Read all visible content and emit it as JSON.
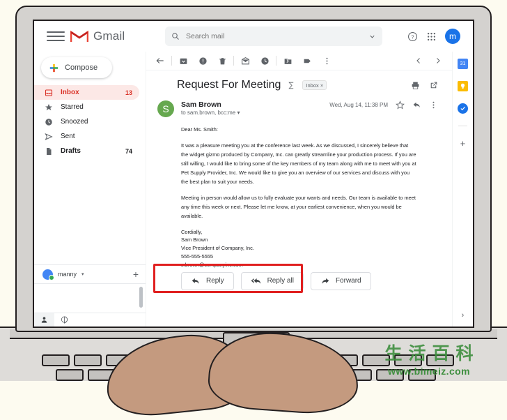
{
  "app": {
    "name": "Gmail"
  },
  "header": {
    "menu_icon": "hamburger-icon",
    "logo_icon": "gmail-m-logo",
    "logo_text": "Gmail",
    "search": {
      "icon": "search-icon",
      "placeholder": "Search mail",
      "value": "",
      "dropdown_icon": "chevron-down-icon"
    },
    "help_icon": "help-circle-icon",
    "apps_icon": "apps-grid-icon",
    "avatar_letter": "m",
    "avatar_color": "#1a73e8"
  },
  "sidebar": {
    "compose": {
      "label": "Compose",
      "icon": "plus-icon"
    },
    "items": [
      {
        "label": "Inbox",
        "icon": "inbox-icon",
        "count": "13",
        "active": true
      },
      {
        "label": "Starred",
        "icon": "star-icon",
        "count": "",
        "active": false
      },
      {
        "label": "Snoozed",
        "icon": "clock-icon",
        "count": "",
        "active": false
      },
      {
        "label": "Sent",
        "icon": "send-icon",
        "count": "",
        "active": false
      },
      {
        "label": "Drafts",
        "icon": "draft-icon",
        "count": "74",
        "active": false
      }
    ],
    "hangouts": {
      "user_name": "manny",
      "caret_icon": "chevron-down-icon",
      "add_icon": "plus-icon",
      "status_color": "#34a853",
      "tabs": [
        "person-icon",
        "hangouts-icon"
      ]
    }
  },
  "toolbar": {
    "icons": [
      "back-arrow-icon",
      "archive-icon",
      "report-spam-icon",
      "delete-icon",
      "mark-unread-icon",
      "snooze-icon",
      "move-to-icon",
      "labels-icon",
      "more-options-icon"
    ],
    "prev_icon": "chevron-left-icon",
    "next_icon": "chevron-right-icon"
  },
  "email": {
    "subject": "Request For Meeting",
    "thread_icon": "sigma-icon",
    "label_chip": "Inbox",
    "label_chip_close": "×",
    "print_icon": "print-icon",
    "popout_icon": "open-in-new-icon",
    "sender_initial": "S",
    "sender_avatar_color": "#66a84f",
    "sender_name": "Sam Brown",
    "recipients": "to sam.brown, bcc:me ▾",
    "date": "Wed, Aug 14, 11:38 PM",
    "star_icon": "star-outline-icon",
    "reply_icon": "reply-arrow-icon",
    "more_icon": "more-vert-icon",
    "body": {
      "greeting": "Dear Ms. Smith:",
      "paragraph1": "It was a pleasure meeting you at the conference last week. As we discussed, I sincerely believe that the widget gizmo produced by Company, Inc. can greatly streamline your production process. If you are still willing, I would like to bring some of the key members of my team along with me to meet with you at Pet Supply Provider, Inc. We would like to give you an overview of our services and discuss with you the best plan to suit your needs.",
      "paragraph2": "Meeting in person would allow us to fully evaluate your wants and needs. Our team is available to meet any time this week or next. Please let me know, at your earliest convenience, when you would be available.",
      "sign_off": "Cordially,",
      "sig_name": "Sam Brown",
      "sig_title": "Vice President of Company, Inc.",
      "sig_phone": "555-555-5555",
      "sig_email": "s.brown@companyinc.com"
    },
    "actions": {
      "reply": {
        "label": "Reply",
        "icon": "reply-arrow-icon"
      },
      "reply_all": {
        "label": "Reply all",
        "icon": "reply-all-arrow-icon"
      },
      "forward": {
        "label": "Forward",
        "icon": "forward-arrow-icon"
      }
    },
    "highlight_color": "#e02020"
  },
  "right_rail": {
    "items": [
      {
        "icon": "google-calendar-icon",
        "label": "31",
        "color": "#4285f4"
      },
      {
        "icon": "google-keep-icon",
        "label": "",
        "color": "#fbbc04"
      },
      {
        "icon": "google-tasks-icon",
        "label": "",
        "color": "#1a73e8"
      }
    ],
    "add_icon": "plus-icon",
    "expand_icon": "chevron-right-icon"
  },
  "watermark": {
    "chinese": "生活百科",
    "url": "www.bimeiz.com",
    "color": "#3f8f3f"
  }
}
